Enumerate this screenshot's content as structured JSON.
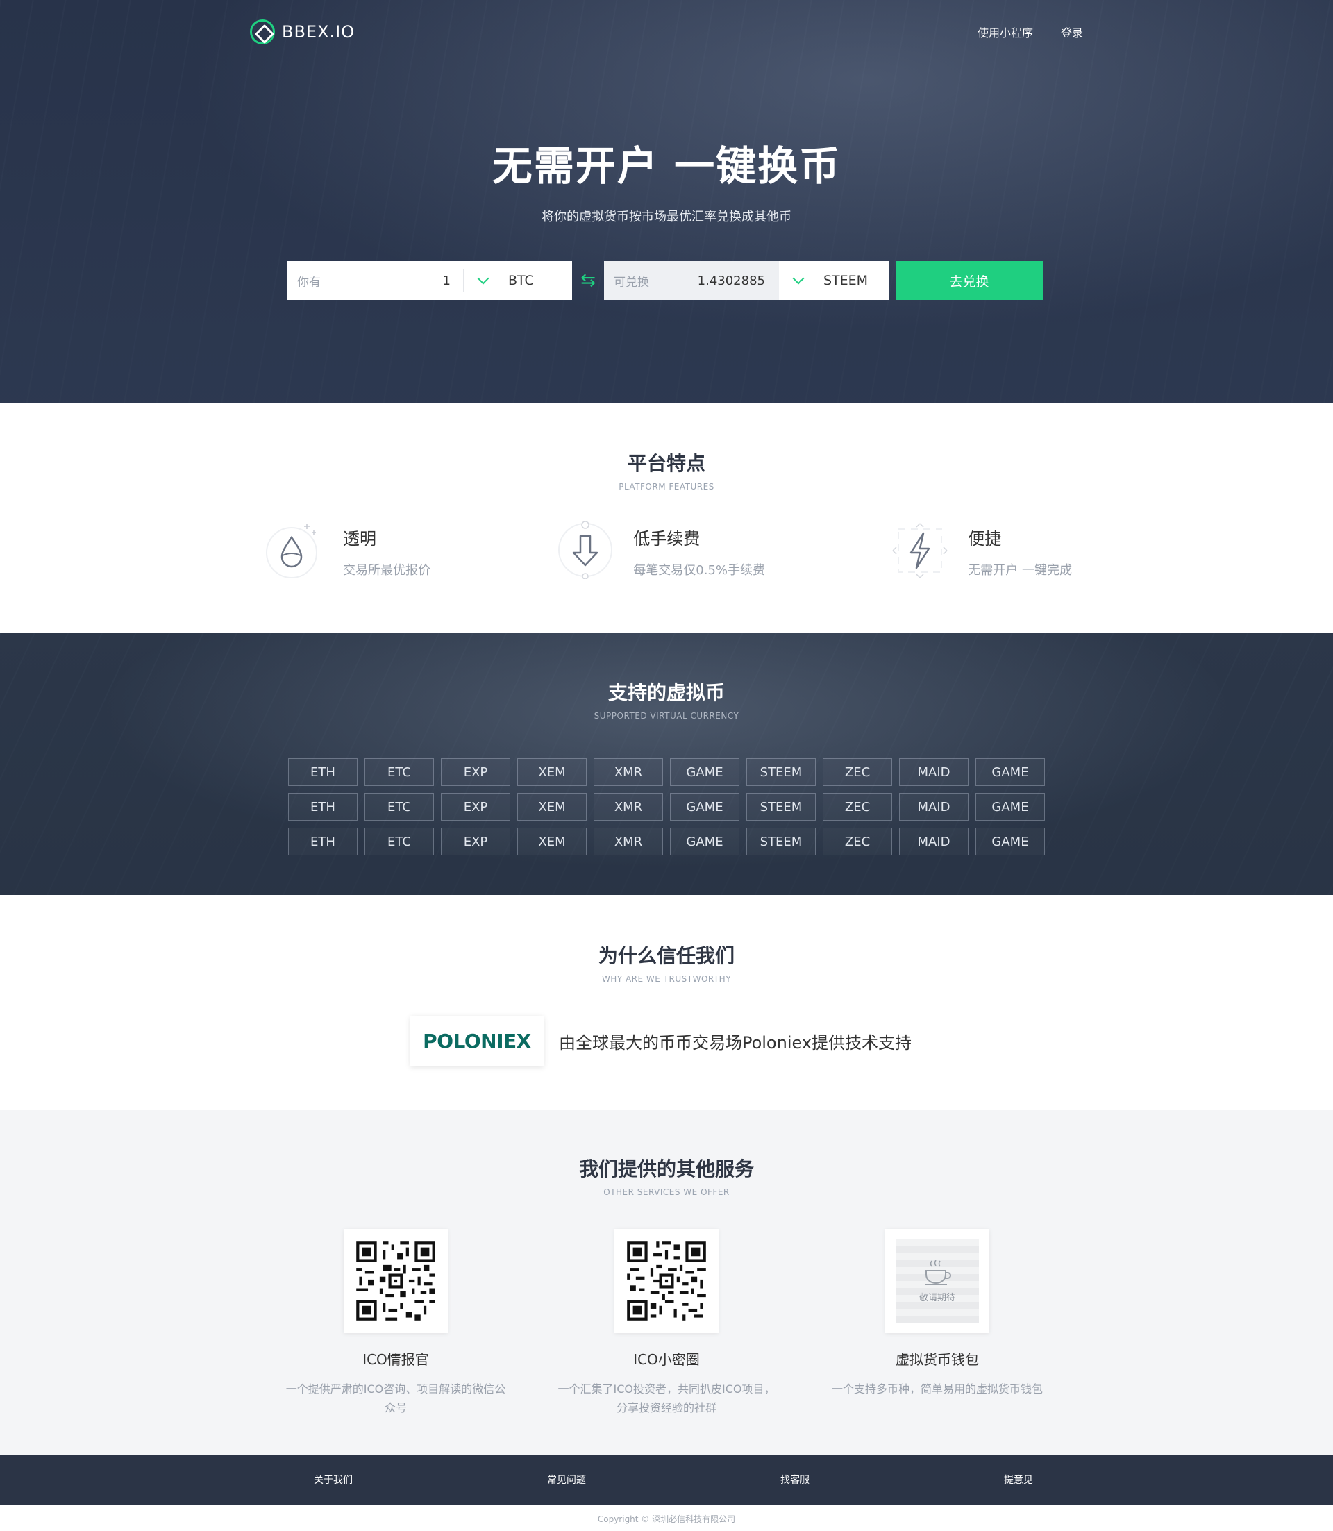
{
  "nav": {
    "brand": "BBEX.IO",
    "links": [
      "使用小程序",
      "登录"
    ]
  },
  "hero": {
    "title": "无需开户 一键换币",
    "subtitle": "将你的虚拟货币按市场最优汇率兑换成其他币",
    "have_label": "你有",
    "have_amount": "1",
    "have_coin": "BTC",
    "get_label": "可兑换",
    "get_amount": "1.4302885",
    "get_coin": "STEEM",
    "button": "去兑换"
  },
  "features": {
    "title": "平台特点",
    "subtitle": "PLATFORM FEATURES",
    "items": [
      {
        "name": "透明",
        "desc": "交易所最优报价",
        "icon": "drop-icon"
      },
      {
        "name": "低手续费",
        "desc": "每笔交易仅0.5%手续费",
        "icon": "arrow-down-icon"
      },
      {
        "name": "便捷",
        "desc": "无需开户 一键完成",
        "icon": "lightning-icon"
      }
    ]
  },
  "coins": {
    "title": "支持的虚拟币",
    "subtitle": "SUPPORTED VIRTUAL CURRENCY",
    "rows": [
      [
        "ETH",
        "ETC",
        "EXP",
        "XEM",
        "XMR",
        "GAME",
        "STEEM",
        "ZEC",
        "MAID",
        "GAME"
      ],
      [
        "ETH",
        "ETC",
        "EXP",
        "XEM",
        "XMR",
        "GAME",
        "STEEM",
        "ZEC",
        "MAID",
        "GAME"
      ],
      [
        "ETH",
        "ETC",
        "EXP",
        "XEM",
        "XMR",
        "GAME",
        "STEEM",
        "ZEC",
        "MAID",
        "GAME"
      ]
    ]
  },
  "trust": {
    "title": "为什么信任我们",
    "subtitle": "WHY ARE WE TRUSTWORTHY",
    "logo": "POLONIEX",
    "text": "由全球最大的币币交易场Poloniex提供技术支持"
  },
  "services": {
    "title": "我们提供的其他服务",
    "subtitle": "OTHER SERVICES WE OFFER",
    "items": [
      {
        "name": "ICO情报官",
        "desc": "一个提供严肃的ICO咨询、项目解读的微信公众号"
      },
      {
        "name": "ICO小密圈",
        "desc": "一个汇集了ICO投资者，共同扒皮ICO项目，分享投资经验的社群"
      },
      {
        "name": "虚拟货币钱包",
        "desc": "一个支持多币种，简单易用的虚拟货币钱包",
        "coming": "敬请期待"
      }
    ]
  },
  "footer": {
    "links": [
      "关于我们",
      "常见问题",
      "找客服",
      "提意见"
    ],
    "copyright": "Copyright © 深圳必信科技有限公司"
  },
  "colors": {
    "accent": "#1fcf80",
    "hero_bg": "#2d3950",
    "footer_bg": "#2b3446"
  }
}
